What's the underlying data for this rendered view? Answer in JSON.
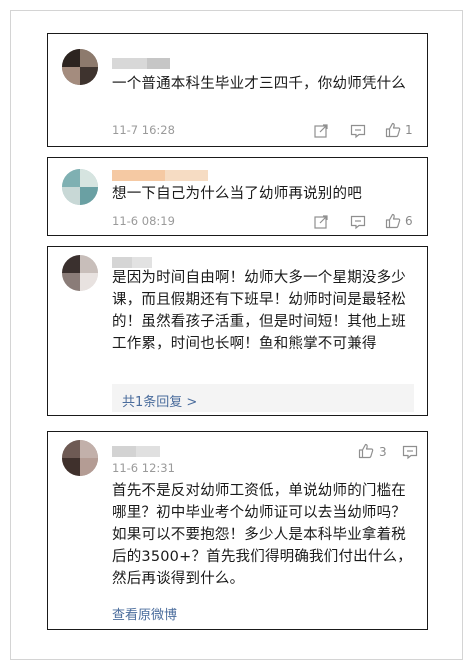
{
  "comments": [
    {
      "text": "一个普通本科生毕业才三四千，你幼师凭什么",
      "time": "11-7 16:28",
      "likes": "1"
    },
    {
      "text": "想一下自己为什么当了幼师再说别的吧",
      "time": "11-6 08:19",
      "likes": "6"
    },
    {
      "text": "是因为时间自由啊！幼师大多一个星期没多少课，而且假期还有下班早！幼师时间是最轻松的！虽然看孩子活重，但是时间短！其他上班工作累，时间也长啊！鱼和熊掌不可兼得",
      "reply_link": "共1条回复 >"
    },
    {
      "time": "11-6 12:31",
      "likes": "3",
      "text": "首先不是反对幼师工资低，单说幼师的门槛在哪里？初中毕业考个幼师证可以去当幼师吗？如果可以不要抱怨！多少人是本科毕业拿着税后的3500+？首先我们得明确我们付出什么，然后再谈得到什么。",
      "view_link": "查看原微博"
    }
  ],
  "icons": {
    "share": "share-icon",
    "comment": "comment-icon",
    "like": "thumb-up-icon"
  },
  "colors": {
    "text": "#1a1a1a",
    "meta": "#9a9a9a",
    "link": "#4a6c9c",
    "reply_bg": "#f4f4f4"
  }
}
